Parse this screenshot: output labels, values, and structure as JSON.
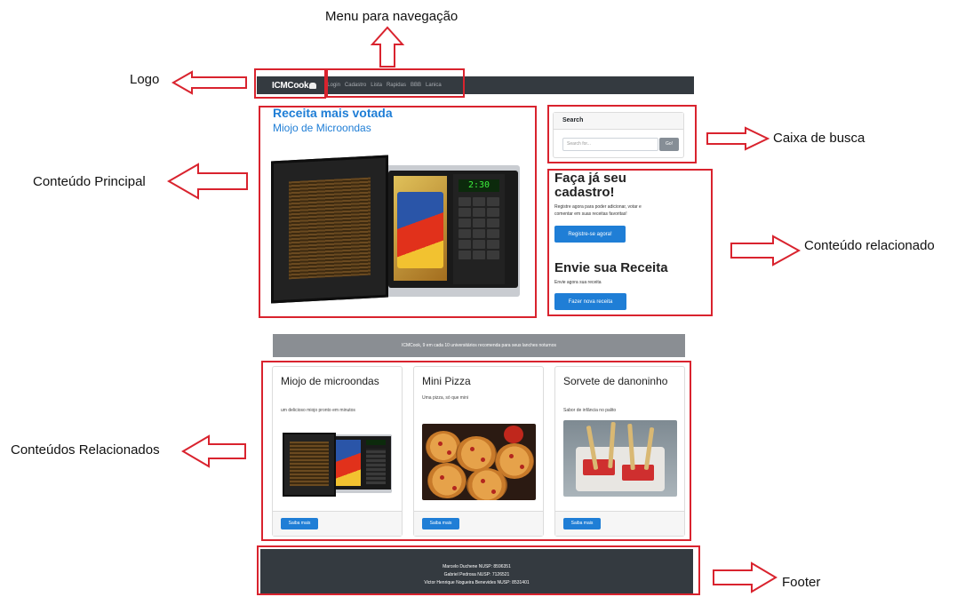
{
  "annotations": {
    "menu": "Menu para navegação",
    "logo": "Logo",
    "main": "Conteúdo Principal",
    "search": "Caixa de busca",
    "related": "Conteúdo relacionado",
    "related_list": "Conteúdos Relacionados",
    "footer": "Footer"
  },
  "navbar": {
    "brand": "ICMCook",
    "links": [
      "Login",
      "Cadastro",
      "Lista",
      "Rapidas",
      "BBB",
      "Lanica"
    ]
  },
  "main": {
    "title": "Receita mais votada",
    "subtitle": "Miojo de Microondas",
    "display_time": "2:30"
  },
  "sidebar": {
    "search_title": "Search",
    "search_placeholder": "Search for...",
    "search_button": "Go!",
    "signup_title_1": "Faça já seu",
    "signup_title_2": "cadastro!",
    "signup_text_1": "Registre agora para poder adicionar, votar e",
    "signup_text_2": "comentar em suas receitas favoritas!",
    "signup_button": "Registre-se agora!",
    "recipe_title": "Envie sua Receita",
    "recipe_text": "Envie agora sua receita",
    "recipe_button": "Fazer nova receita"
  },
  "strip": {
    "text": "ICMCook, 9 em cada 10 universitários recomenda para seus lanches noturnos"
  },
  "cards": [
    {
      "title": "Miojo de microondas",
      "desc": "um delicioso miojo pronto em minutos",
      "button": "Saiba mais"
    },
    {
      "title": "Mini Pizza",
      "desc": "Uma pizza, só que mini",
      "button": "Saiba mais"
    },
    {
      "title": "Sorvete de danoninho",
      "desc": "Sabor de infância no palito",
      "button": "Saiba mais"
    }
  ],
  "footer": {
    "line1": "Marcelo Duchene NUSP: 8596351",
    "line2": "Gabriel Pedrosa NUSP: 7126521",
    "line3": "Victor Henrique Nogueira Benevides NUSP: 8531401"
  },
  "colors": {
    "annotation_red": "#d9232e",
    "primary": "#1f7ed6",
    "navbar": "#343a40"
  }
}
